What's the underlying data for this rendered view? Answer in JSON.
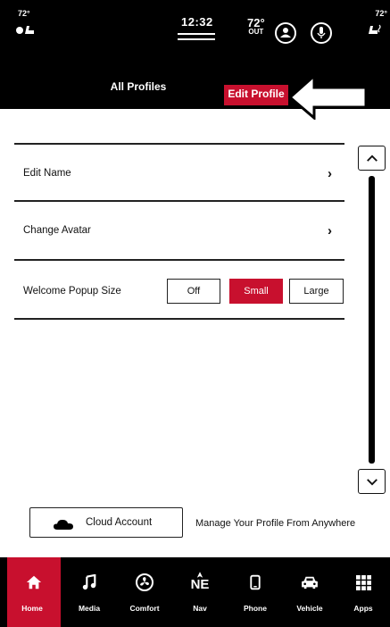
{
  "status_bar": {
    "left_temp": "72°",
    "right_temp": "72°",
    "clock": "12:32",
    "outside_temp": "72°",
    "outside_label": "OUT",
    "icons": [
      "heated-seat-icon",
      "profile-icon",
      "microphone-icon",
      "heated-seat-icon"
    ]
  },
  "tabs": [
    {
      "label": "All Profiles",
      "active": false
    },
    {
      "label": "Edit Profile",
      "active": true
    }
  ],
  "rows": {
    "edit_name": "Edit Name",
    "change_avatar": "Change Avatar",
    "welcome_popup": "Welcome Popup Size"
  },
  "popup_size": {
    "options": [
      "Off",
      "Small",
      "Large"
    ],
    "selected": "Small"
  },
  "cloud": {
    "button_label": "Cloud Account",
    "description": "Manage Your Profile From Anywhere"
  },
  "bottom_nav": [
    {
      "label": "Home",
      "icon": "home-icon",
      "active": true
    },
    {
      "label": "Media",
      "icon": "music-note-icon",
      "active": false
    },
    {
      "label": "Comfort",
      "icon": "climate-fan-icon",
      "active": false
    },
    {
      "label": "Nav",
      "icon": "compass-icon",
      "heading": "NE",
      "active": false
    },
    {
      "label": "Phone",
      "icon": "phone-icon",
      "active": false
    },
    {
      "label": "Vehicle",
      "icon": "car-icon",
      "active": false
    },
    {
      "label": "Apps",
      "icon": "grid-icon",
      "active": false
    }
  ],
  "colors": {
    "accent": "#c8102e",
    "background": "#ffffff",
    "bars": "#000000"
  }
}
